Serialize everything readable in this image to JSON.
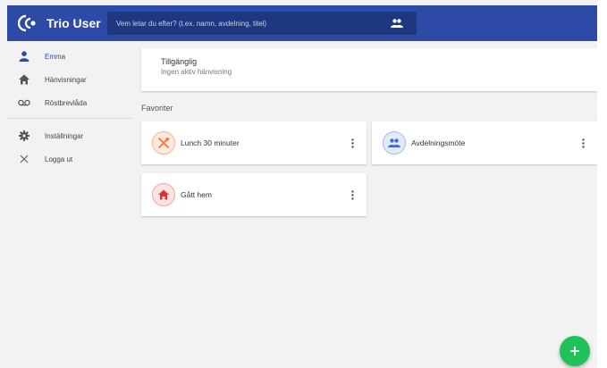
{
  "app": {
    "name": "Trio User"
  },
  "search": {
    "placeholder": "Vem letar du efter? (t.ex. namn, avdelning, titel)"
  },
  "sidebar": {
    "items": [
      {
        "label": "Emma",
        "icon": "person-icon",
        "active": true
      },
      {
        "label": "Hänvisningar",
        "icon": "home-icon"
      },
      {
        "label": "Röstbrevlåda",
        "icon": "voicemail-icon"
      }
    ],
    "bottom_items": [
      {
        "label": "Inställningar",
        "icon": "gear-icon"
      },
      {
        "label": "Logga ut",
        "icon": "close-icon"
      }
    ]
  },
  "status": {
    "title": "Tillgänglig",
    "subtitle": "Ingen aktiv hänvisning"
  },
  "favorites": {
    "heading": "Favoriter",
    "items": [
      {
        "label": "Lunch 30 minuter",
        "icon": "utensils-icon",
        "color": "#f07a3a"
      },
      {
        "label": "Avdelningsmöte",
        "icon": "group-icon",
        "color": "#3f6ad8"
      },
      {
        "label": "Gått hem",
        "icon": "home-icon",
        "color": "#e03030"
      }
    ]
  },
  "colors": {
    "primary": "#2c4aa6",
    "fab": "#21c15a"
  }
}
